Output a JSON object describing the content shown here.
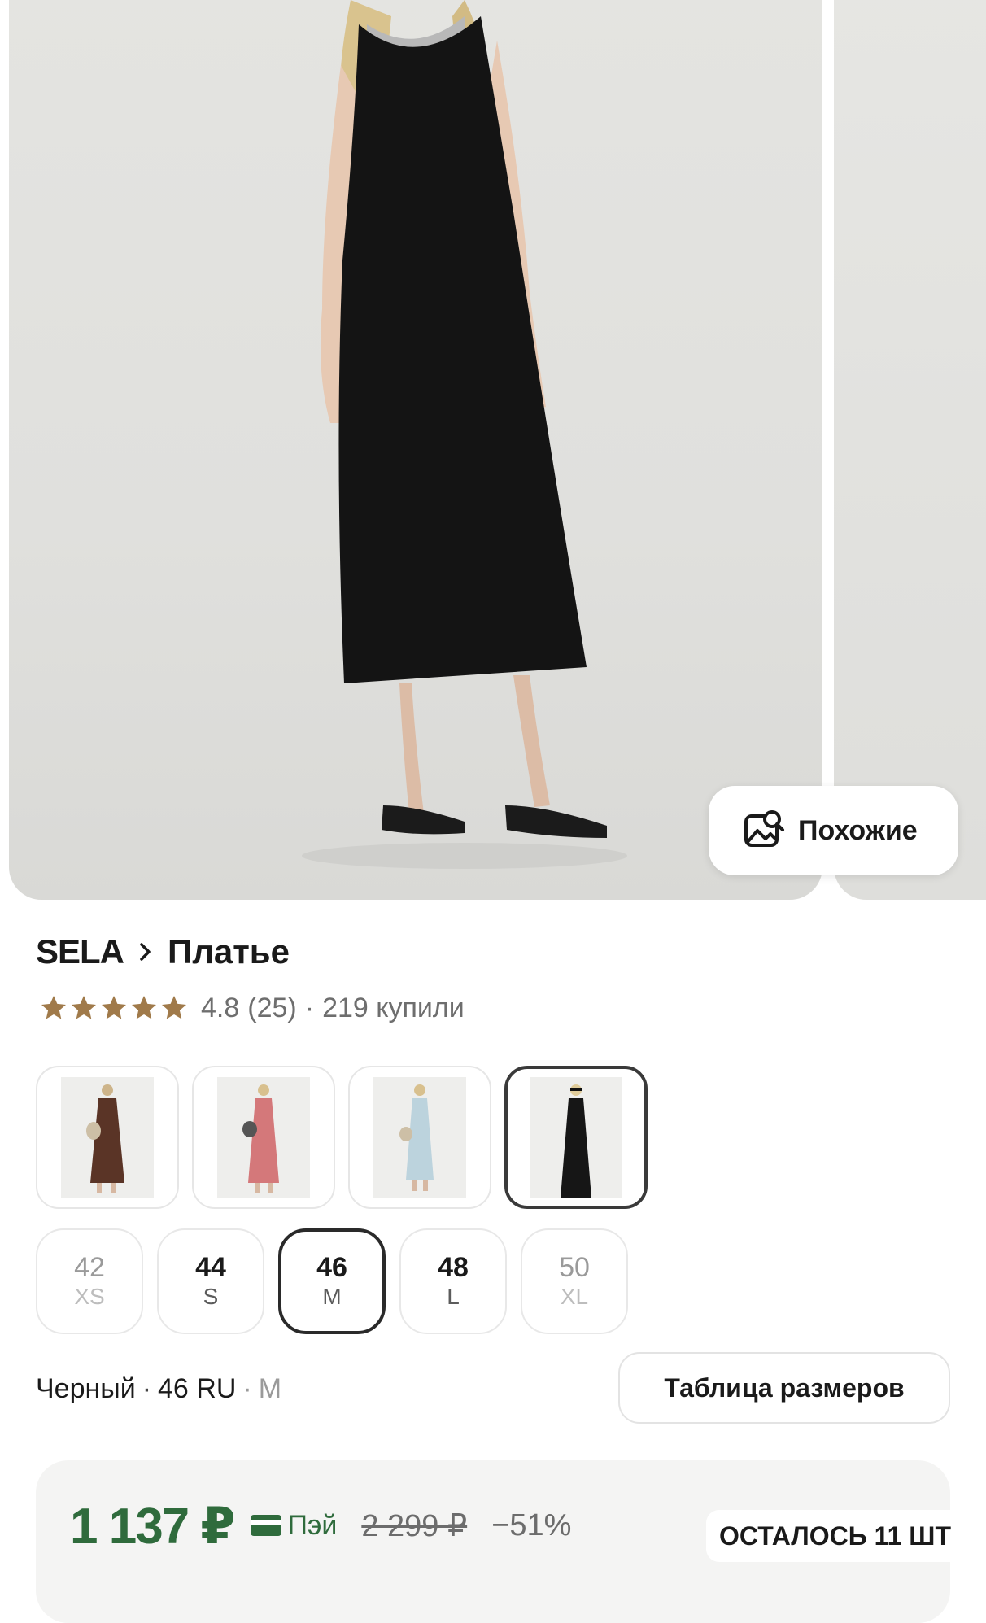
{
  "gallery": {
    "similar_button_label": "Похожие"
  },
  "product": {
    "brand": "SELA",
    "category": "Платье",
    "rating": "4.8",
    "reviews": "(25)",
    "separator": "·",
    "purchased": "219 купили"
  },
  "variants": [
    {
      "color_name": "brown",
      "hex": "#5a3426"
    },
    {
      "color_name": "pink",
      "hex": "#d4787a"
    },
    {
      "color_name": "light-blue",
      "hex": "#bcd3dd"
    },
    {
      "color_name": "black",
      "hex": "#161616",
      "selected": true
    }
  ],
  "sizes": [
    {
      "num": "42",
      "letter": "XS",
      "available": false
    },
    {
      "num": "44",
      "letter": "S",
      "available": true
    },
    {
      "num": "46",
      "letter": "M",
      "available": true,
      "selected": true
    },
    {
      "num": "48",
      "letter": "L",
      "available": true
    },
    {
      "num": "50",
      "letter": "XL",
      "available": false
    }
  ],
  "selection": {
    "color": "Черный",
    "dot": "·",
    "size_ru": "46 RU",
    "size_letter": "M"
  },
  "size_table_button": "Таблица размеров",
  "price": {
    "current": "1 137 ₽",
    "pay_label": "Пэй",
    "old": "2 299 ₽",
    "discount": "−51%",
    "stock": "ОСТАЛОСЬ 11 ШТ"
  },
  "colors": {
    "price_green": "#2f6b3c",
    "star": "#a07a4a"
  }
}
